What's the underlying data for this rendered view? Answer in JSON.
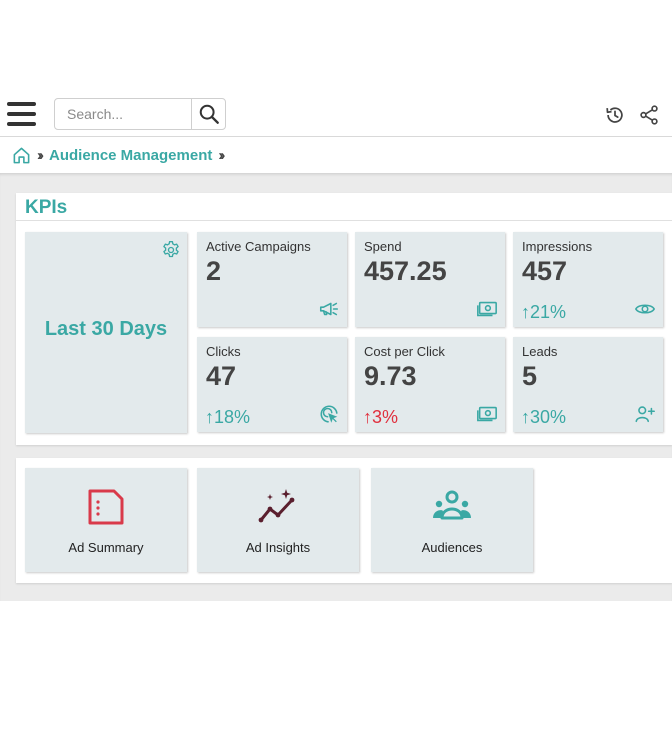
{
  "header": {
    "search": {
      "placeholder": "Search...",
      "value": ""
    },
    "icons": [
      "menu-icon",
      "search-icon",
      "history-icon",
      "share-icon"
    ]
  },
  "breadcrumb": {
    "home_icon": "home-icon",
    "items": [
      "Audience Management"
    ]
  },
  "kpis": {
    "title": "KPIs",
    "range": {
      "label": "Last 30 Days",
      "icon": "gear-icon"
    },
    "cards": [
      {
        "label": "Active Campaigns",
        "value": "2",
        "change": "",
        "direction": "",
        "icon": "megaphone-icon"
      },
      {
        "label": "Spend",
        "value": "457.25",
        "change": "",
        "direction": "",
        "icon": "money-icon"
      },
      {
        "label": "Impressions",
        "value": "457",
        "change": "21%",
        "direction": "up",
        "icon": "eye-icon"
      },
      {
        "label": "Clicks",
        "value": "47",
        "change": "18%",
        "direction": "up",
        "icon": "click-icon"
      },
      {
        "label": "Cost per Click",
        "value": "9.73",
        "change": "3%",
        "direction": "up",
        "icon": "money-icon"
      },
      {
        "label": "Leads",
        "value": "5",
        "change": "30%",
        "direction": "up",
        "icon": "add-user-icon"
      }
    ]
  },
  "navigation": [
    {
      "label": "Ad Summary",
      "icon": "document-icon"
    },
    {
      "label": "Ad Insights",
      "icon": "insights-chart-icon"
    },
    {
      "label": "Audiences",
      "icon": "users-group-icon"
    }
  ],
  "colors": {
    "accent": "#3aa8a4",
    "negative": "#e0303e",
    "card_bg": "#e3eaec",
    "ad_summary_icon": "#d93a4a",
    "ad_insights_icon": "#5a1f2e"
  }
}
